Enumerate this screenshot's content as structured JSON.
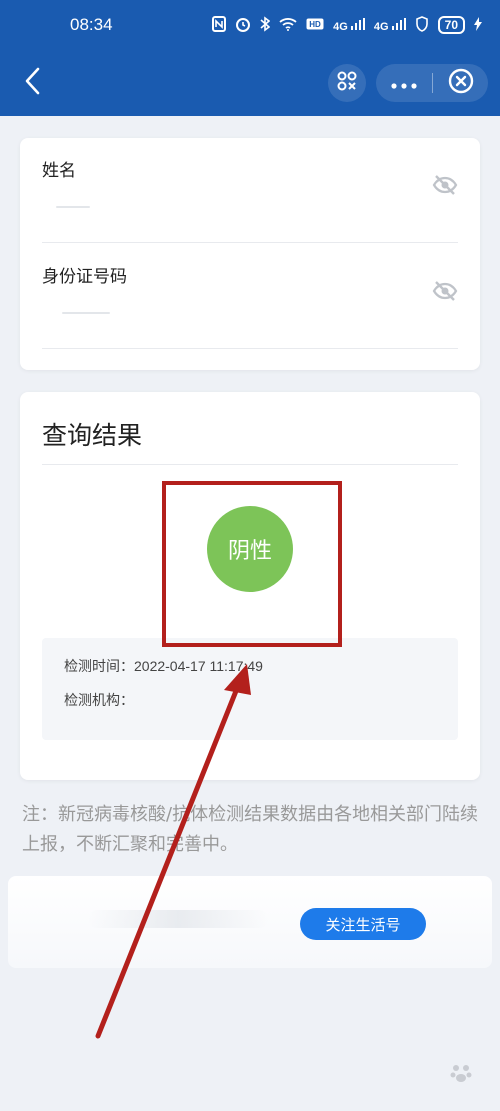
{
  "status_bar": {
    "time": "08:34",
    "network_1": "4G",
    "network_2": "4G",
    "battery": "70"
  },
  "form": {
    "name_label": "姓名",
    "id_label": "身份证号码"
  },
  "result": {
    "title": "查询结果",
    "status": "阴性",
    "test_time_label": "检测时间：",
    "test_time_value": "2022-04-17 11:17:49",
    "institution_label": "检测机构：",
    "institution_value": ""
  },
  "note": "注：新冠病毒核酸/抗体检测结果数据由各地相关部门陆续上报，不断汇聚和完善中。",
  "follow_button": "关注生活号",
  "colors": {
    "brand_blue": "#1a5bb0",
    "negative_green": "#7dc458",
    "highlight_red": "#b3201c",
    "button_blue": "#1e7bea"
  },
  "icons": {
    "back": "chevron-left-icon",
    "scan": "scan-icon",
    "more": "more-dots-icon",
    "close": "close-circle-icon",
    "eye_hidden": "eye-off-icon"
  }
}
